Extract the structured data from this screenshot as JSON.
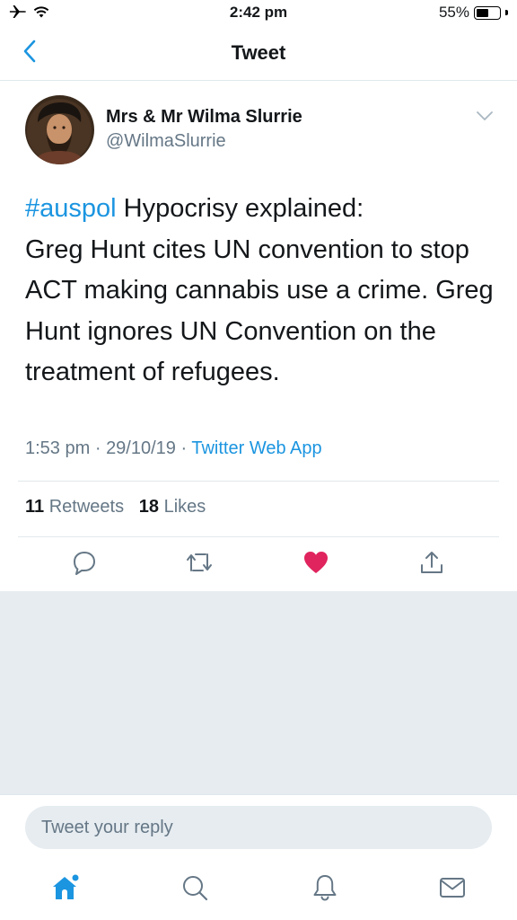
{
  "status_bar": {
    "time": "2:42 pm",
    "battery_percent": "55%",
    "battery_level": 0.55,
    "icons": [
      "airplane-icon",
      "wifi-icon",
      "battery-icon"
    ]
  },
  "nav": {
    "title": "Tweet",
    "back_icon": "chevron-left-icon"
  },
  "tweet": {
    "author_name": "Mrs & Mr Wilma Slurrie",
    "author_handle": "@WilmaSlurrie",
    "hashtag": "#auspol",
    "text_line1_rest": " Hypocrisy explained:",
    "text_rest": "Greg Hunt cites UN convention to stop ACT making cannabis use a crime. Greg Hunt ignores UN Convention on the treatment of refugees.",
    "time": "1:53 pm",
    "separator": "·",
    "date": "29/10/19",
    "source": "Twitter Web App",
    "retweet_count": "11",
    "retweet_label": "Retweets",
    "like_count": "18",
    "like_label": "Likes"
  },
  "actions": [
    "reply-icon",
    "retweet-icon",
    "like-icon",
    "share-icon"
  ],
  "colors": {
    "accent": "#1b95e0",
    "like": "#e0245e",
    "secondary_text": "#657786",
    "background_gray": "#e6ecf0"
  },
  "reply": {
    "placeholder": "Tweet your reply"
  },
  "tab_bar": [
    "home-icon",
    "search-icon",
    "notifications-icon",
    "messages-icon"
  ]
}
